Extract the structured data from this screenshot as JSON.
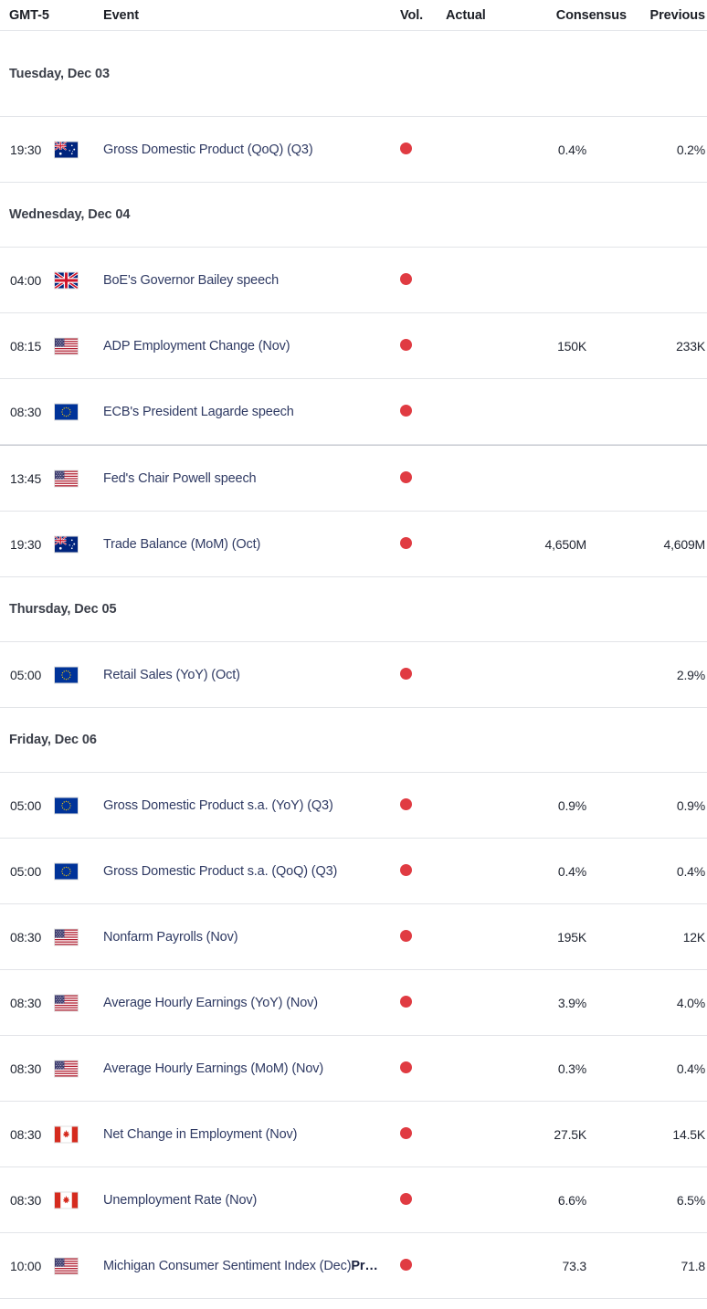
{
  "header": {
    "timezone": "GMT-5",
    "event": "Event",
    "vol": "Vol.",
    "actual": "Actual",
    "consensus": "Consensus",
    "previous": "Previous"
  },
  "colors": {
    "volatility_high": "#e03b42",
    "link": "#2f3a63",
    "row_border": "#e2e4e8",
    "day_label": "#3b3f49"
  },
  "days": [
    {
      "label": "Tuesday, Dec 03",
      "events": [
        {
          "time": "19:30",
          "flag": "flag-australia",
          "name": "Gross Domestic Product (QoQ) (Q3)",
          "name_suffix": "",
          "volatility": "high",
          "actual": "",
          "consensus": "0.4%",
          "previous": "0.2%"
        }
      ]
    },
    {
      "label": "Wednesday, Dec 04",
      "events": [
        {
          "time": "04:00",
          "flag": "flag-united-kingdom",
          "name": "BoE's Governor Bailey speech",
          "name_suffix": "",
          "volatility": "high",
          "actual": "",
          "consensus": "",
          "previous": ""
        },
        {
          "time": "08:15",
          "flag": "flag-united-states",
          "name": "ADP Employment Change (Nov)",
          "name_suffix": "",
          "volatility": "high",
          "actual": "",
          "consensus": "150K",
          "previous": "233K"
        },
        {
          "time": "08:30",
          "flag": "flag-european-union",
          "name": "ECB's President Lagarde speech",
          "name_suffix": "",
          "volatility": "high",
          "actual": "",
          "consensus": "",
          "previous": ""
        },
        {
          "time": "13:45",
          "flag": "flag-united-states",
          "name": "Fed's Chair Powell speech",
          "name_suffix": "",
          "volatility": "high",
          "actual": "",
          "consensus": "",
          "previous": ""
        },
        {
          "time": "19:30",
          "flag": "flag-australia",
          "name": "Trade Balance (MoM) (Oct)",
          "name_suffix": "",
          "volatility": "high",
          "actual": "",
          "consensus": "4,650M",
          "previous": "4,609M"
        }
      ]
    },
    {
      "label": "Thursday, Dec 05",
      "events": [
        {
          "time": "05:00",
          "flag": "flag-european-union",
          "name": "Retail Sales (YoY) (Oct)",
          "name_suffix": "",
          "volatility": "high",
          "actual": "",
          "consensus": "",
          "previous": "2.9%"
        }
      ]
    },
    {
      "label": "Friday, Dec 06",
      "events": [
        {
          "time": "05:00",
          "flag": "flag-european-union",
          "name": "Gross Domestic Product s.a. (YoY) (Q3)",
          "name_suffix": "",
          "volatility": "high",
          "actual": "",
          "consensus": "0.9%",
          "previous": "0.9%"
        },
        {
          "time": "05:00",
          "flag": "flag-european-union",
          "name": "Gross Domestic Product s.a. (QoQ) (Q3)",
          "name_suffix": "",
          "volatility": "high",
          "actual": "",
          "consensus": "0.4%",
          "previous": "0.4%"
        },
        {
          "time": "08:30",
          "flag": "flag-united-states",
          "name": "Nonfarm Payrolls (Nov)",
          "name_suffix": "",
          "volatility": "high",
          "actual": "",
          "consensus": "195K",
          "previous": "12K"
        },
        {
          "time": "08:30",
          "flag": "flag-united-states",
          "name": "Average Hourly Earnings (YoY) (Nov)",
          "name_suffix": "",
          "volatility": "high",
          "actual": "",
          "consensus": "3.9%",
          "previous": "4.0%"
        },
        {
          "time": "08:30",
          "flag": "flag-united-states",
          "name": "Average Hourly Earnings (MoM) (Nov)",
          "name_suffix": "",
          "volatility": "high",
          "actual": "",
          "consensus": "0.3%",
          "previous": "0.4%"
        },
        {
          "time": "08:30",
          "flag": "flag-canada",
          "name": "Net Change in Employment (Nov)",
          "name_suffix": "",
          "volatility": "high",
          "actual": "",
          "consensus": "27.5K",
          "previous": "14.5K"
        },
        {
          "time": "08:30",
          "flag": "flag-canada",
          "name": "Unemployment Rate (Nov)",
          "name_suffix": "",
          "volatility": "high",
          "actual": "",
          "consensus": "6.6%",
          "previous": "6.5%"
        },
        {
          "time": "10:00",
          "flag": "flag-united-states",
          "name": "Michigan Consumer Sentiment Index (Dec)",
          "name_suffix": "Pr…",
          "volatility": "high",
          "actual": "",
          "consensus": "73.3",
          "previous": "71.8"
        }
      ]
    }
  ]
}
